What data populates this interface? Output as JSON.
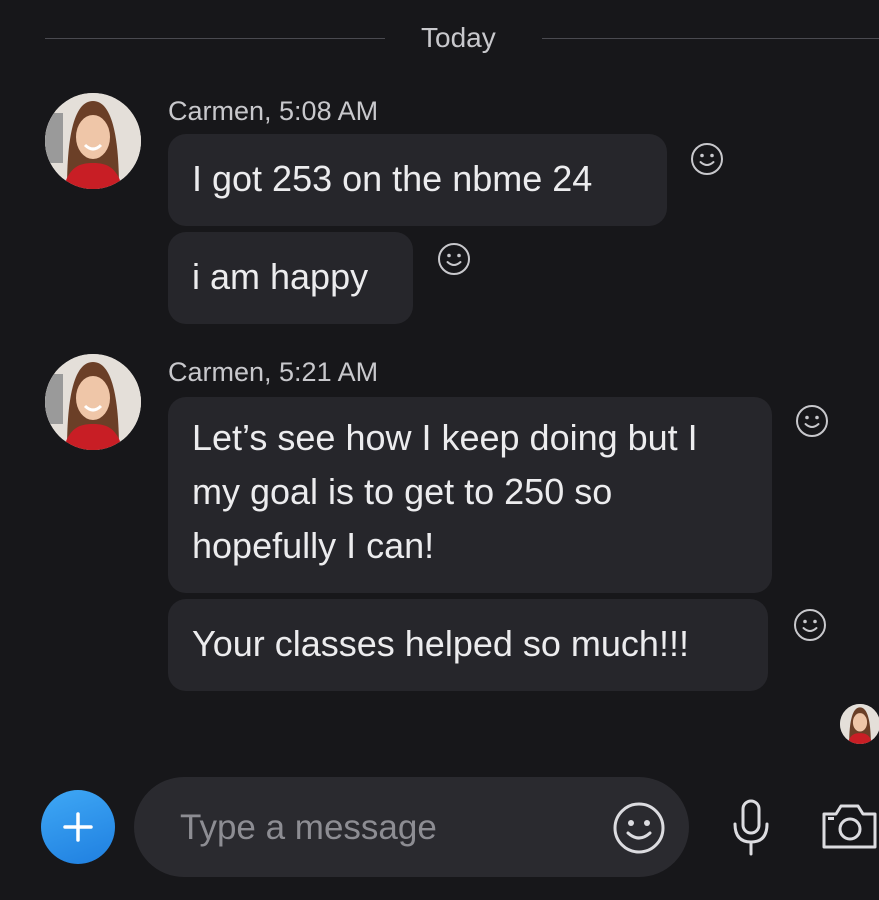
{
  "divider": {
    "label": "Today"
  },
  "colors": {
    "background": "#17171a",
    "bubble": "#26262b",
    "composer": "#2a2a2f",
    "accent": "#1f7fe0",
    "text": "#ececee",
    "muted": "#c8c8cc"
  },
  "messages": [
    {
      "sender_line": "Carmen, 5:08 AM",
      "avatar_icon": "contact-avatar",
      "bubbles": [
        {
          "text": "I got 253 on the nbme 24",
          "reaction_icon": "smiley-reaction-icon"
        },
        {
          "text": "i am happy",
          "reaction_icon": "smiley-reaction-icon"
        }
      ]
    },
    {
      "sender_line": "Carmen, 5:21 AM",
      "avatar_icon": "contact-avatar",
      "bubbles": [
        {
          "text": "Let’s see how I keep doing but I my goal is to get to 250 so hopefully I can!",
          "reaction_icon": "smiley-reaction-icon"
        },
        {
          "text": "Your classes helped so much!!!",
          "reaction_icon": "smiley-reaction-icon"
        }
      ]
    }
  ],
  "composer": {
    "placeholder": "Type a message",
    "value": "",
    "add_icon": "plus-icon",
    "emoji_icon": "emoji-icon",
    "mic_icon": "microphone-icon",
    "camera_icon": "camera-icon"
  }
}
